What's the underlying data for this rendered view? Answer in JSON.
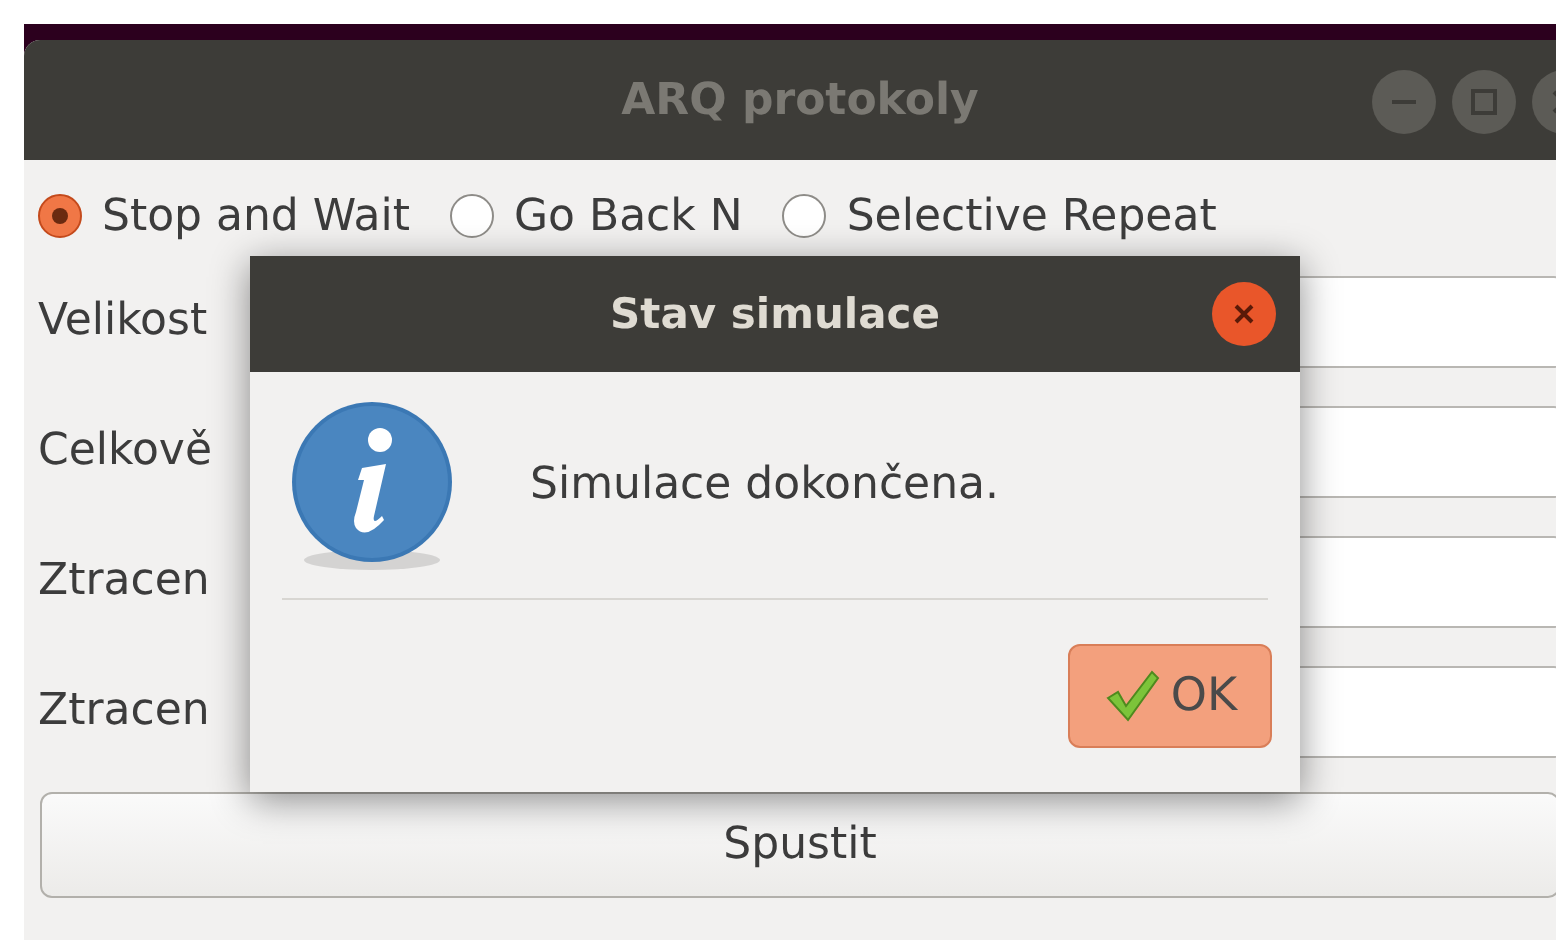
{
  "window": {
    "title": "ARQ protokoly"
  },
  "protocols": [
    {
      "label": "Stop and Wait",
      "selected": true
    },
    {
      "label": "Go Back N",
      "selected": false
    },
    {
      "label": "Selective Repeat",
      "selected": false
    }
  ],
  "fields": [
    {
      "label": "Velikost"
    },
    {
      "label": "Celkově"
    },
    {
      "label": "Ztracen"
    },
    {
      "label": "Ztracen"
    }
  ],
  "run_button": "Spustit",
  "dialog": {
    "title": "Stav simulace",
    "message": "Simulace dokončena.",
    "ok_button": "OK"
  }
}
